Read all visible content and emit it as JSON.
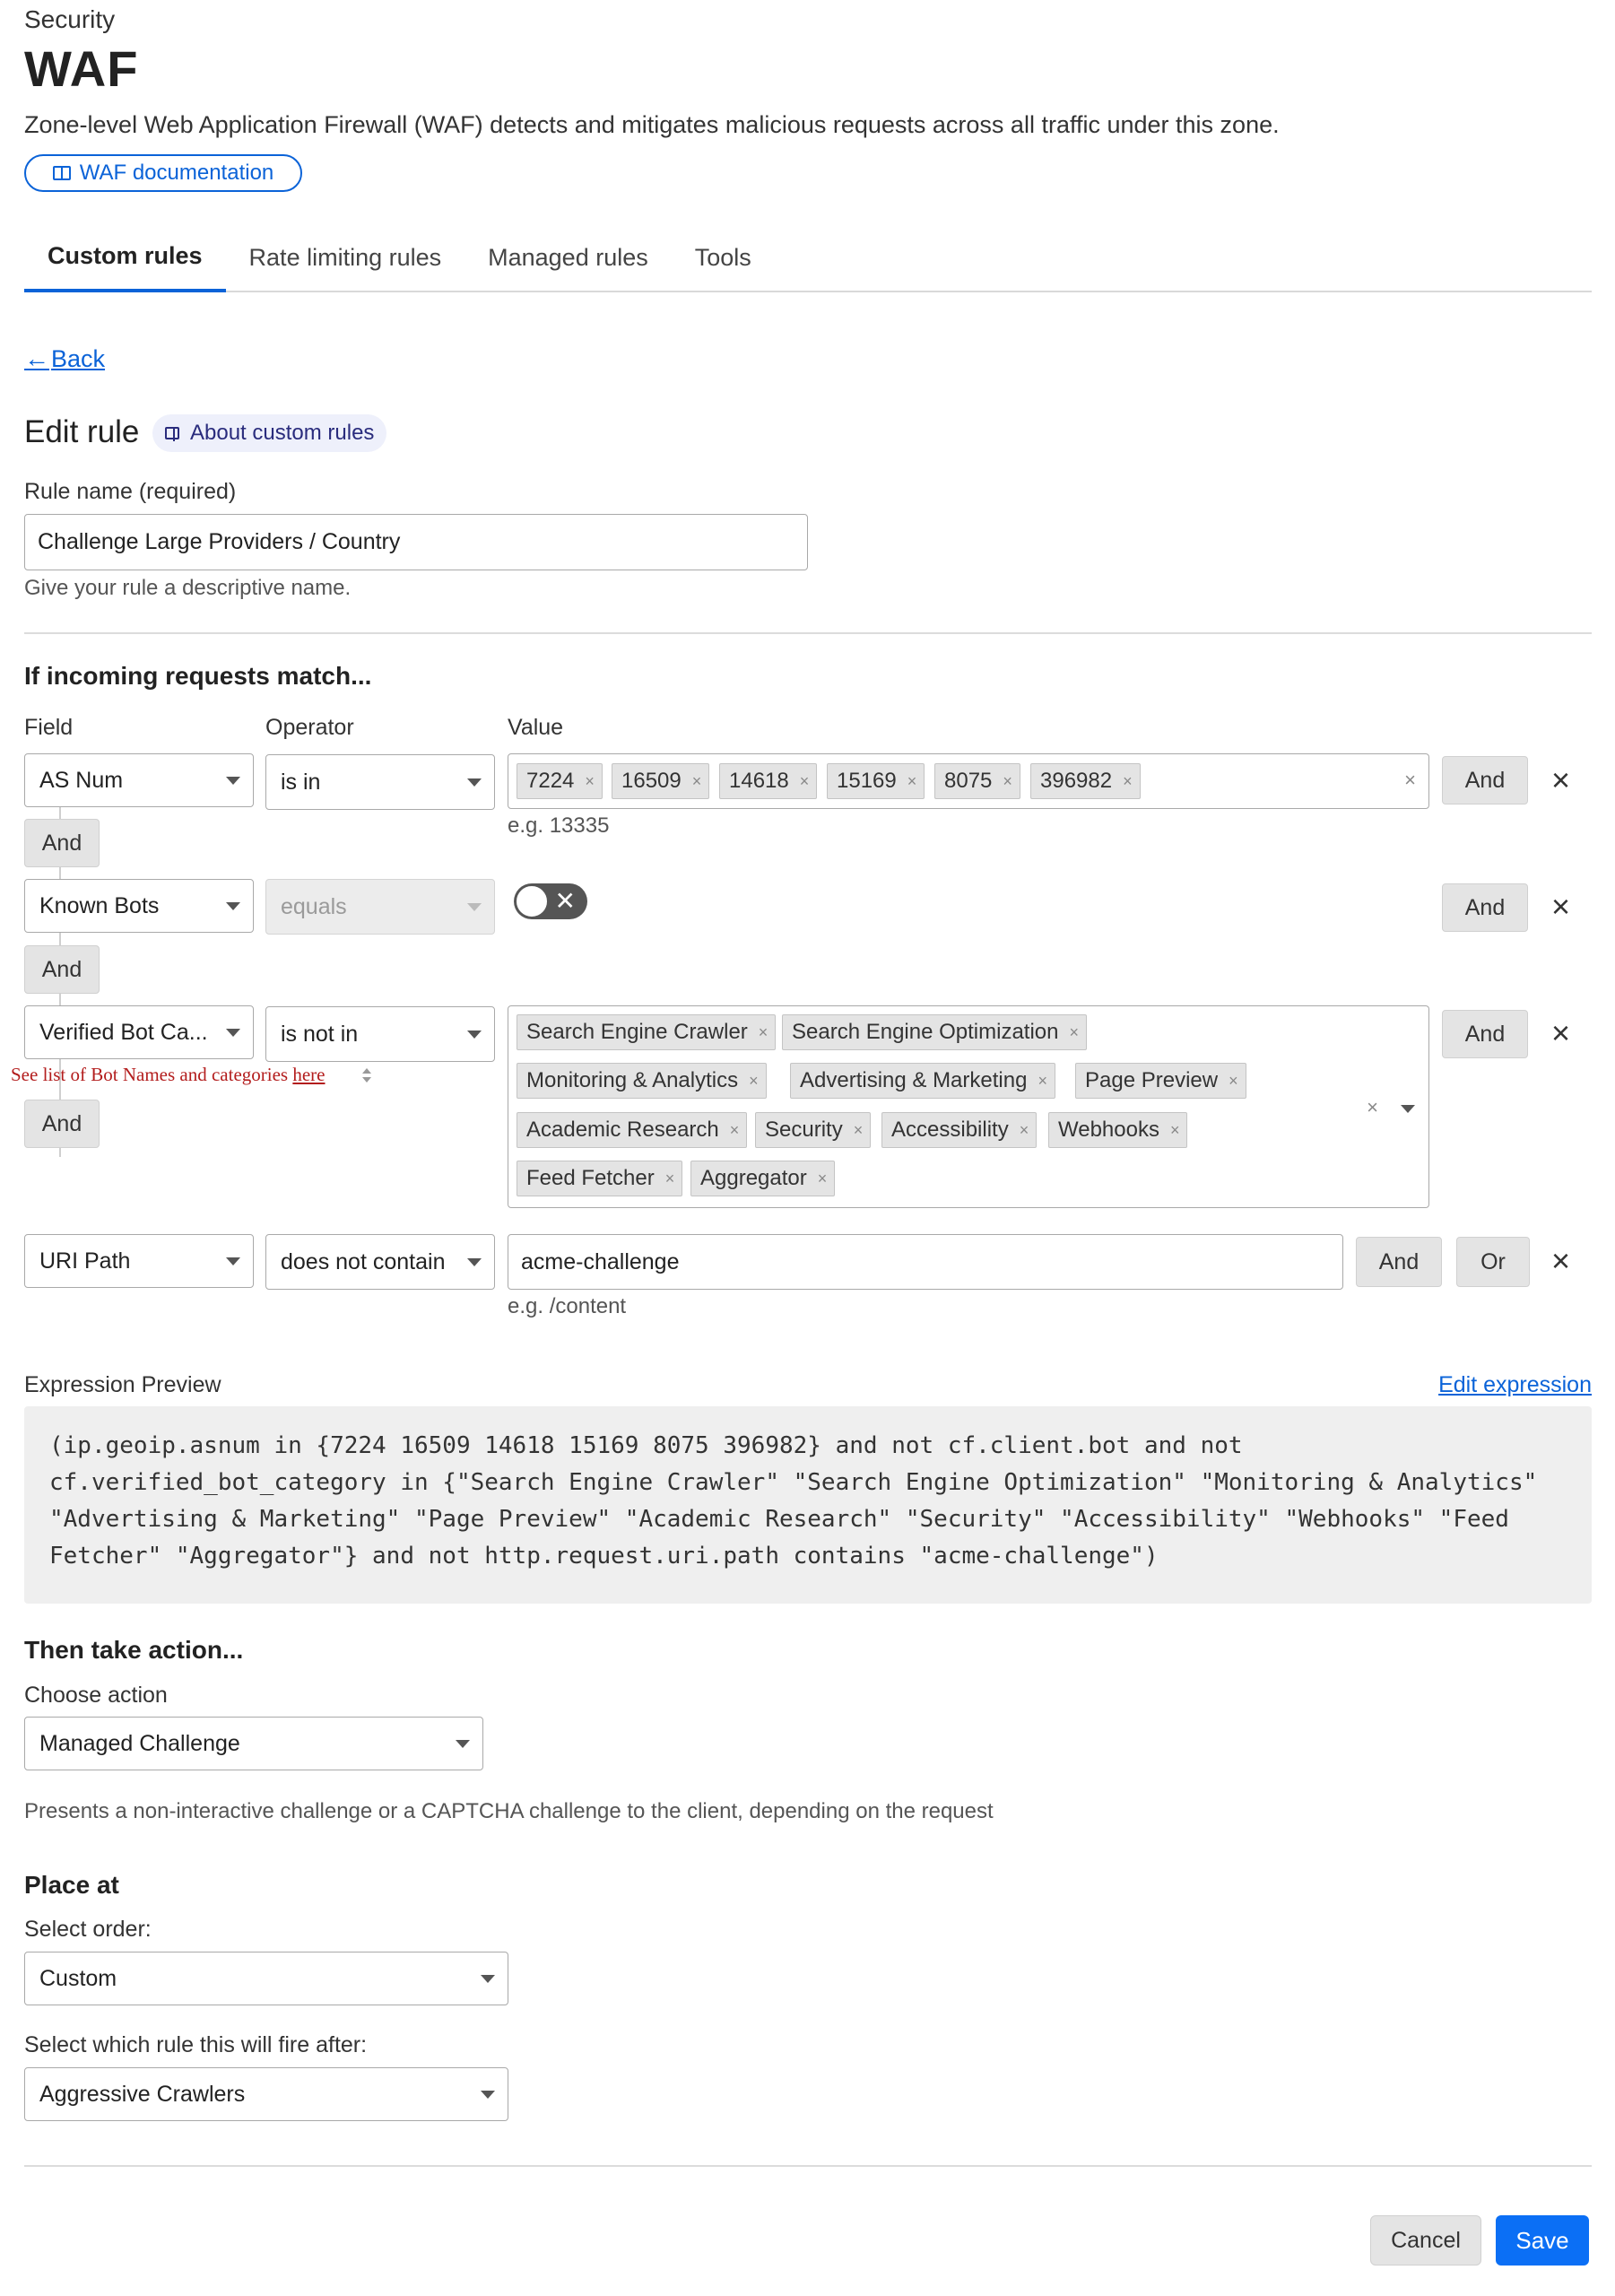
{
  "header": {
    "kicker": "Security",
    "title": "WAF",
    "description": "Zone-level Web Application Firewall (WAF) detects and mitigates malicious requests across all traffic under this zone.",
    "doc_button": "WAF documentation"
  },
  "tabs": [
    {
      "label": "Custom rules",
      "active": true
    },
    {
      "label": "Rate limiting rules",
      "active": false
    },
    {
      "label": "Managed rules",
      "active": false
    },
    {
      "label": "Tools",
      "active": false
    }
  ],
  "back_label": "Back",
  "edit": {
    "title": "Edit rule",
    "about_label": "About custom rules",
    "rule_name_label": "Rule name (required)",
    "rule_name_value": "Challenge Large Providers / Country",
    "rule_name_help": "Give your rule a descriptive name."
  },
  "match": {
    "heading": "If incoming requests match...",
    "col_field": "Field",
    "col_operator": "Operator",
    "col_value": "Value",
    "and_label": "And",
    "or_label": "Or",
    "rows": [
      {
        "field": "AS Num",
        "operator": "is in",
        "tags": [
          "7224",
          "16509",
          "14618",
          "15169",
          "8075",
          "396982"
        ],
        "help": "e.g. 13335"
      },
      {
        "field": "Known Bots",
        "operator": "equals",
        "toggle_on": false
      },
      {
        "field": "Verified Bot Ca...",
        "operator": "is not in",
        "field_help": "See list of Bot Names and categories",
        "field_help_link": "here",
        "tags": [
          "Search Engine Crawler",
          "Search Engine Optimization",
          "Monitoring & Analytics",
          "Advertising & Marketing",
          "Page Preview",
          "Academic Research",
          "Security",
          "Accessibility",
          "Webhooks",
          "Feed Fetcher",
          "Aggregator"
        ]
      },
      {
        "field": "URI Path",
        "operator": "does not contain",
        "value": "acme-challenge",
        "help": "e.g. /content"
      }
    ]
  },
  "expression": {
    "label": "Expression Preview",
    "edit_link": "Edit expression",
    "code": "(ip.geoip.asnum in {7224 16509 14618 15169 8075 396982} and not cf.client.bot and not cf.verified_bot_category in {\"Search Engine Crawler\" \"Search Engine Optimization\" \"Monitoring & Analytics\" \"Advertising & Marketing\" \"Page Preview\" \"Academic Research\" \"Security\" \"Accessibility\" \"Webhooks\" \"Feed Fetcher\" \"Aggregator\"} and not http.request.uri.path contains \"acme-challenge\")"
  },
  "action": {
    "heading": "Then take action...",
    "choose_label": "Choose action",
    "value": "Managed Challenge",
    "description": "Presents a non-interactive challenge or a CAPTCHA challenge to the client, depending on the request"
  },
  "place": {
    "heading": "Place at",
    "order_label": "Select order:",
    "order_value": "Custom",
    "after_label": "Select which rule this will fire after:",
    "after_value": "Aggressive Crawlers"
  },
  "footer": {
    "cancel": "Cancel",
    "save": "Save"
  },
  "colors": {
    "primary": "#0b6ff5",
    "link": "#0b63d8",
    "help_red": "#b31d1d"
  }
}
